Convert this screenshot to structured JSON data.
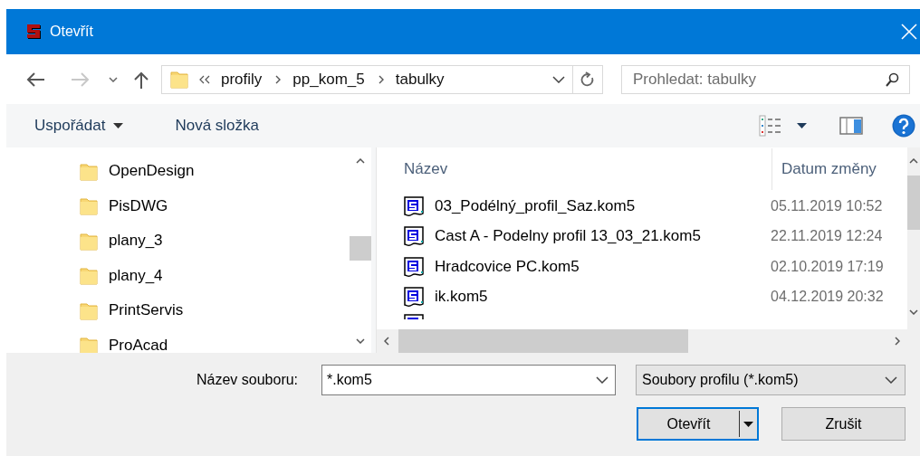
{
  "window": {
    "title": "Otevřít"
  },
  "nav": {
    "back": {
      "disabled": false
    },
    "forward": {
      "disabled": true
    }
  },
  "address": {
    "crumbs": [
      "profily",
      "pp_kom_5",
      "tabulky"
    ]
  },
  "search": {
    "placeholder": "Prohledat: tabulky"
  },
  "toolbar": {
    "organize": "Uspořádat",
    "new_folder": "Nová složka"
  },
  "tree": {
    "items": [
      {
        "label": "OpenDesign"
      },
      {
        "label": "PisDWG"
      },
      {
        "label": "plany_3"
      },
      {
        "label": "plany_4"
      },
      {
        "label": "PrintServis"
      },
      {
        "label": "ProAcad"
      }
    ]
  },
  "file_list": {
    "columns": [
      "Název",
      "Datum změny"
    ],
    "rows": [
      {
        "name": "03_Podélný_profil_Saz.kom5",
        "date": "05.11.2019 10:52"
      },
      {
        "name": "Cast A - Podelny profil 13_03_21.kom5",
        "date": "22.11.2019 12:24"
      },
      {
        "name": "Hradcovice PC.kom5",
        "date": "02.10.2019 17:19"
      },
      {
        "name": "ik.kom5",
        "date": "04.12.2019 20:32"
      }
    ]
  },
  "footer": {
    "filename_label": "Název souboru:",
    "filename": "*.kom5",
    "filetype": "Soubory profilu (*.kom5)",
    "open_button": "Otevřít",
    "cancel_button": "Zrušit"
  }
}
